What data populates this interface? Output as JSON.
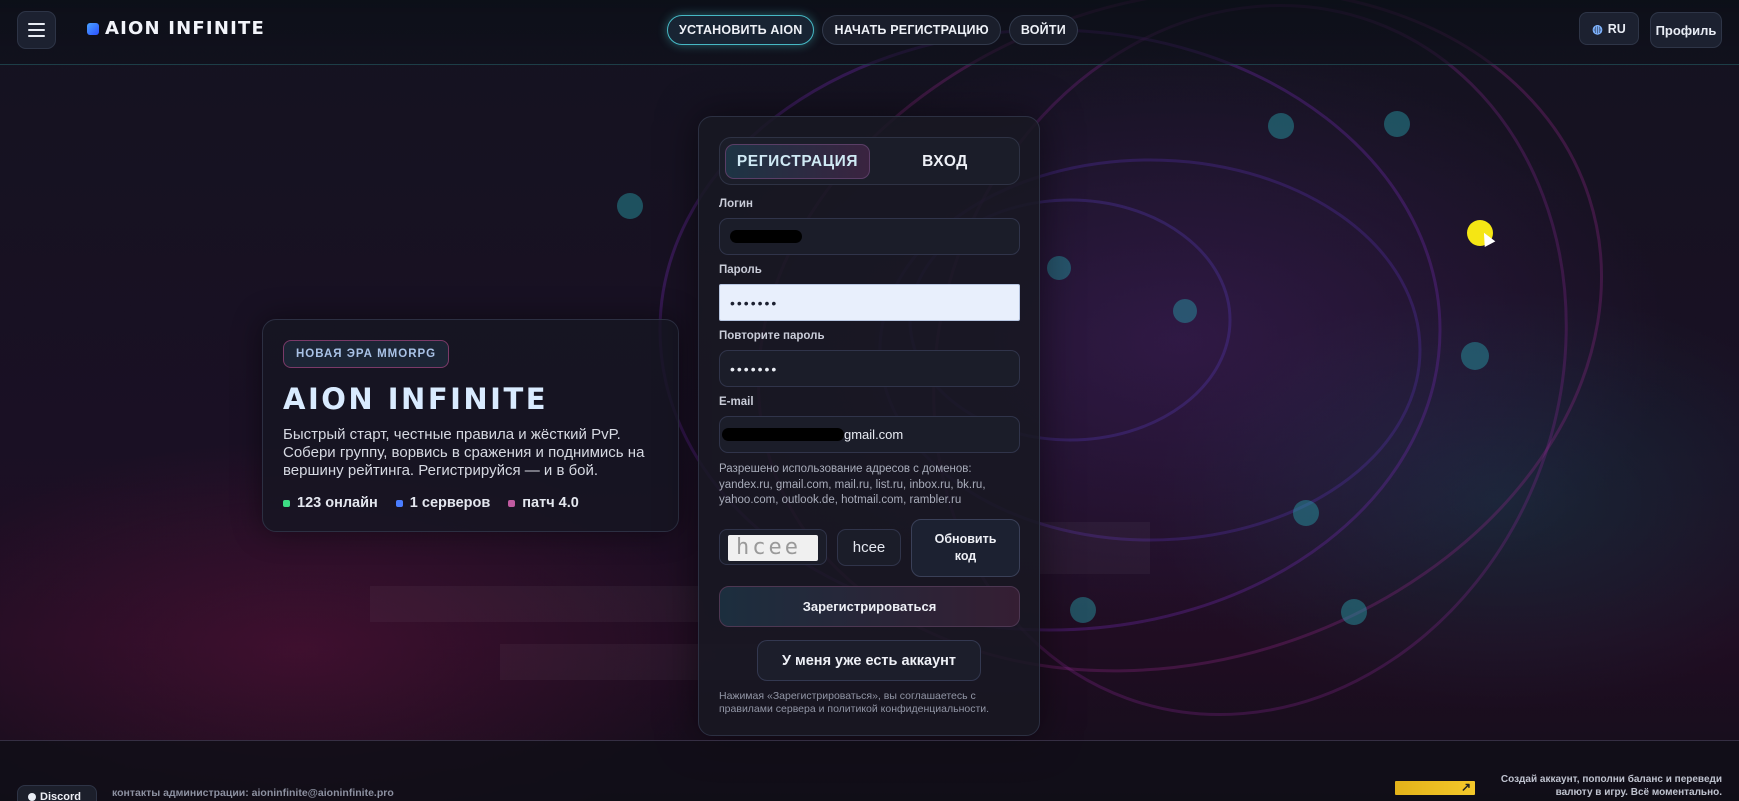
{
  "header": {
    "brand": "AION INFINITE",
    "nav": [
      "УСТАНОВИТЬ AION",
      "НАЧАТЬ РЕГИСТРАЦИЮ",
      "ВОЙТИ"
    ],
    "lang": "RU",
    "profile": "Профиль"
  },
  "hero": {
    "badge": "НОВАЯ ЭРА MMORPG",
    "title": "AION INFINITE",
    "description": "Быстрый старт, честные правила и жёсткий PvP. Собери группу, ворвись в сражения и поднимись на вершину рейтинга. Регистрируйся — и в бой.",
    "stats": {
      "online": "123 онлайн",
      "servers": "1 серверов",
      "patch": "патч 4.0"
    }
  },
  "form": {
    "tabs": {
      "register": "РЕГИСТРАЦИЯ",
      "login": "ВХОД"
    },
    "login_label": "Логин",
    "password_label": "Пароль",
    "password_value": "•••••••",
    "repeat_label": "Повторите пароль",
    "repeat_value": "•••••••",
    "email_label": "E-mail",
    "email_visible_suffix": "gmail.com",
    "hint": "Разрешено использование адресов с доменов: yandex.ru, gmail.com, mail.ru, list.ru, inbox.ru, bk.ru, yahoo.com, outlook.de, hotmail.com, rambler.ru",
    "captcha_image_text": "hcee",
    "captcha_value": "hcee",
    "refresh_label": "Обновить код",
    "submit_label": "Зарегистрироваться",
    "have_account_label": "У меня уже есть аккаунт",
    "terms": "Нажимая «Зарегистрироваться», вы соглашаетесь с правилами сервера и политикой конфиденциальности."
  },
  "footer": {
    "discord": "Discord",
    "contacts": "контакты администрации: aioninfinite@aioninfinite.pro",
    "promo": "Создай аккаунт, пополни баланс и переведи валюту в игру. Всё моментально."
  },
  "colors": {
    "accent_cyan": "#46b8c4",
    "accent_magenta": "#7a3a68",
    "online_dot": "#3ddc84",
    "servers_dot": "#4a7dff",
    "patch_dot": "#c05aa0",
    "cursor_highlight": "#f5e614"
  },
  "icons": {
    "menu": "hamburger-icon",
    "brand": "brand-square-icon",
    "lang": "globe-icon",
    "promo": "external-arrow-icon"
  }
}
